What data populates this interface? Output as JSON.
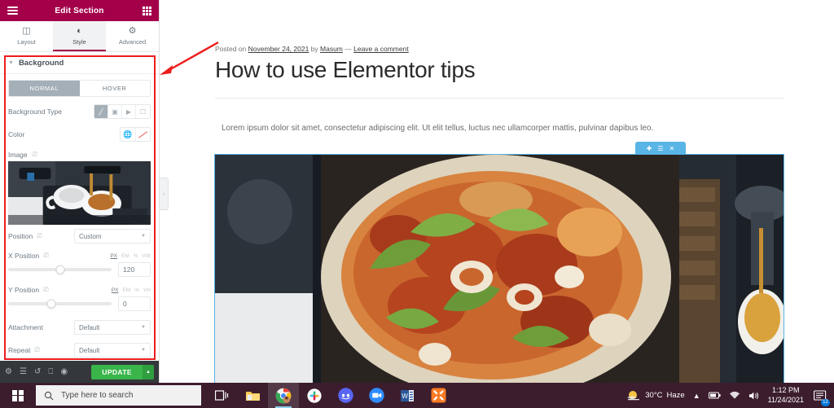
{
  "panel": {
    "title": "Edit Section",
    "menu_icon": "hamburger-icon",
    "apps_icon": "grid-apps-icon",
    "tabs": [
      {
        "label": "Layout",
        "icon": "columns-icon",
        "active": false
      },
      {
        "label": "Style",
        "icon": "contrast-circle-icon",
        "active": true
      },
      {
        "label": "Advanced",
        "icon": "gear-icon",
        "active": false
      }
    ],
    "section": {
      "title": "Background",
      "collapse_icon": "caret-down-icon"
    },
    "state_tabs": [
      {
        "label": "NORMAL",
        "active": true
      },
      {
        "label": "HOVER",
        "active": false
      }
    ],
    "background_type": {
      "label": "Background Type",
      "options": [
        {
          "name": "classic",
          "icon": "brush-icon",
          "active": true
        },
        {
          "name": "gradient",
          "icon": "gradient-icon",
          "active": false
        },
        {
          "name": "video",
          "icon": "video-camera-icon",
          "active": false
        },
        {
          "name": "slideshow",
          "icon": "slideshow-icon",
          "active": false
        }
      ]
    },
    "color": {
      "label": "Color",
      "globe_icon": "globe-icon",
      "swatch_icon": "no-color-swatch-icon"
    },
    "image": {
      "label": "Image",
      "responsive_icon": "desktop-icon",
      "thumbnail_alt": "espresso-machine-pouring-coffee"
    },
    "position": {
      "label": "Position",
      "responsive_icon": "desktop-icon",
      "value": "Custom",
      "caret_icon": "caret-down-icon"
    },
    "x_position": {
      "label": "X Position",
      "responsive_icon": "desktop-icon",
      "units": [
        "PX",
        "EM",
        "%",
        "VW"
      ],
      "active_unit": "PX",
      "value": "120",
      "slider_percent": 50
    },
    "y_position": {
      "label": "Y Position",
      "responsive_icon": "desktop-icon",
      "units": [
        "PX",
        "EM",
        "%",
        "VH"
      ],
      "active_unit": "PX",
      "value": "0",
      "slider_percent": 42
    },
    "attachment": {
      "label": "Attachment",
      "value": "Default",
      "caret_icon": "caret-down-icon"
    },
    "repeat": {
      "label": "Repeat",
      "responsive_icon": "desktop-icon",
      "value": "Default",
      "caret_icon": "caret-down-icon"
    },
    "footer": {
      "icons": [
        {
          "name": "settings-gear-icon",
          "glyph": "⚙"
        },
        {
          "name": "navigator-layers-icon",
          "glyph": "☲"
        },
        {
          "name": "history-icon",
          "glyph": "↺"
        },
        {
          "name": "responsive-mode-icon",
          "glyph": "❐"
        },
        {
          "name": "preview-changes-eye-icon",
          "glyph": "◉"
        }
      ],
      "update_label": "UPDATE",
      "update_arrow_icon": "caret-up-icon"
    }
  },
  "canvas": {
    "collapse_icon": "collapse-panel-icon",
    "post": {
      "meta_prefix": "Posted on ",
      "date": "November 24, 2021",
      "by_text": " by ",
      "author": "Masum",
      "separator": " — ",
      "comment_link": "Leave a comment",
      "title": "How to use Elementor tips",
      "paragraph": "Lorem ipsum dolor sit amet, consectetur adipiscing elit. Ut elit tellus, luctus nec ullamcorper mattis, pulvinar dapibus leo."
    },
    "section_handle": {
      "add_icon": "plus-icon",
      "columns_icon": "columns-grid-icon",
      "close_icon": "close-x-icon",
      "color": "#59b5e6"
    },
    "hero_alt": "pizza-on-dark-coffee-machine-background"
  },
  "taskbar": {
    "start_icon": "windows-logo-icon",
    "search": {
      "icon": "search-icon",
      "placeholder": "Type here to search"
    },
    "apps": [
      {
        "name": "task-view-icon",
        "active": false
      },
      {
        "name": "file-explorer-icon",
        "active": false
      },
      {
        "name": "google-chrome-icon",
        "active": true
      },
      {
        "name": "slack-icon",
        "active": false
      },
      {
        "name": "discord-icon",
        "active": false
      },
      {
        "name": "zoom-icon",
        "active": false
      },
      {
        "name": "microsoft-word-icon",
        "active": false
      },
      {
        "name": "xampp-icon",
        "active": false
      }
    ],
    "tray": {
      "weather_icon": "haze-sun-icon",
      "temperature": "30°C",
      "condition": "Haze",
      "chevron_icon": "show-hidden-icons-chevron",
      "battery_icon": "battery-icon",
      "wifi_icon": "wifi-icon",
      "volume_icon": "speaker-icon",
      "time": "1:12 PM",
      "date": "11/24/2021",
      "notification_icon": "action-center-icon",
      "notification_count": "12"
    }
  },
  "colors": {
    "panel_header": "#a4004a",
    "accent_green": "#39b54a",
    "section_blue": "#59b5e6",
    "annotation_red": "#ee1c1c",
    "taskbar": "#3b1d2e"
  }
}
